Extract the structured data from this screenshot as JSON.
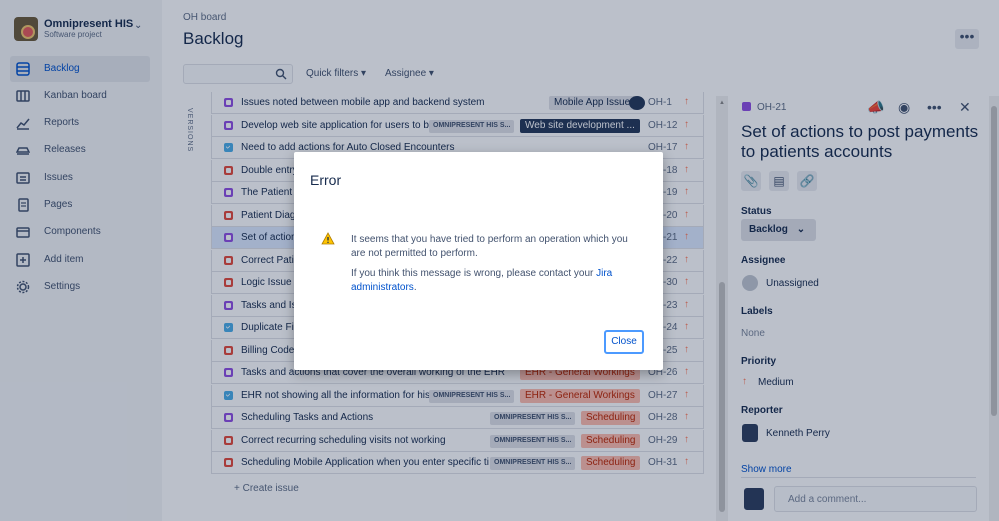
{
  "sidebar": {
    "project_name": "Omnipresent HIS",
    "project_type": "Software project",
    "items": [
      {
        "label": "Backlog",
        "icon": "backlog-icon",
        "active": true
      },
      {
        "label": "Kanban board",
        "icon": "board-icon"
      },
      {
        "label": "Reports",
        "icon": "reports-icon"
      },
      {
        "label": "Releases",
        "icon": "releases-icon"
      },
      {
        "label": "Issues",
        "icon": "issues-icon"
      },
      {
        "label": "Pages",
        "icon": "pages-icon"
      },
      {
        "label": "Components",
        "icon": "components-icon"
      },
      {
        "label": "Add item",
        "icon": "add-item-icon"
      },
      {
        "label": "Settings",
        "icon": "settings-icon"
      }
    ]
  },
  "header": {
    "breadcrumb": "OH board",
    "title": "Backlog",
    "more_label": "•••"
  },
  "toolbar": {
    "search_placeholder": "",
    "quick_filters": "Quick filters",
    "assignee": "Assignee"
  },
  "versions_label": "VERSIONS",
  "issues": [
    {
      "type": "story",
      "summary": "Issues noted between mobile app and backend system",
      "lozenge": "",
      "epic": "Mobile App Issues",
      "epic_color": "#dfe1e6",
      "key": "OH-1"
    },
    {
      "type": "story",
      "summary": "Develop web site application for users to b",
      "lozenge": "OMNIPRESENT HIS S...",
      "epic": "Web site development ...",
      "epic_color": "#253858",
      "key": "OH-12"
    },
    {
      "type": "task",
      "summary": "Need to add actions for Auto Closed Encounters",
      "lozenge": "",
      "epic": "",
      "key": "OH-17"
    },
    {
      "type": "bug",
      "summary": "Double entry",
      "lozenge": "",
      "epic": "",
      "key": "OH-18"
    },
    {
      "type": "story",
      "summary": "The Patient S",
      "lozenge": "",
      "epic": "",
      "key": "OH-19"
    },
    {
      "type": "bug",
      "summary": "Patient Diagn",
      "lozenge": "",
      "epic": "",
      "key": "OH-20"
    },
    {
      "type": "story",
      "summary": "Set of action",
      "lozenge": "",
      "epic": "",
      "key": "OH-21",
      "selected": true
    },
    {
      "type": "bug",
      "summary": "Correct Patie",
      "lozenge": "",
      "epic": "",
      "key": "OH-22"
    },
    {
      "type": "bug",
      "summary": "Logic Issue w",
      "lozenge": "",
      "epic": "",
      "key": "OH-30"
    },
    {
      "type": "story",
      "summary": "Tasks and Iss",
      "lozenge": "",
      "epic": "",
      "key": "OH-23"
    },
    {
      "type": "task",
      "summary": "Duplicate File",
      "lozenge": "",
      "epic": "",
      "key": "OH-24"
    },
    {
      "type": "bug",
      "summary": "Billing Codes",
      "lozenge": "",
      "epic": "",
      "key": "OH-25"
    },
    {
      "type": "story",
      "summary": "Tasks and actions that cover the overall working of the EHR",
      "lozenge": "",
      "epic": "EHR - General Workings",
      "epic_color": "#ffbdad",
      "key": "OH-26"
    },
    {
      "type": "task",
      "summary": "EHR not showing all the information for histo",
      "lozenge": "OMNIPRESENT HIS S...",
      "epic": "EHR - General Workings",
      "epic_color": "#ffbdad",
      "key": "OH-27"
    },
    {
      "type": "story",
      "summary": "Scheduling Tasks and Actions",
      "lozenge": "OMNIPRESENT HIS S...",
      "epic": "Scheduling",
      "epic_color": "#ffbdad",
      "key": "OH-28"
    },
    {
      "type": "bug",
      "summary": "Correct recurring scheduling visits not working",
      "lozenge": "OMNIPRESENT HIS S...",
      "epic": "Scheduling",
      "epic_color": "#ffbdad",
      "key": "OH-29"
    },
    {
      "type": "bug",
      "summary": "Scheduling Mobile Application when you enter specific ti",
      "lozenge": "OMNIPRESENT HIS S...",
      "epic": "Scheduling",
      "epic_color": "#ffbdad",
      "key": "OH-31"
    }
  ],
  "create_issue": "+ Create issue",
  "detail": {
    "key": "OH-21",
    "title": "Set of actions to post payments to patients accounts",
    "status_label": "Status",
    "status_value": "Backlog",
    "assignee_label": "Assignee",
    "assignee_value": "Unassigned",
    "labels_label": "Labels",
    "labels_value": "None",
    "priority_label": "Priority",
    "priority_value": "Medium",
    "reporter_label": "Reporter",
    "reporter_value": "Kenneth Perry",
    "show_more": "Show more",
    "comment_placeholder": "Add a comment..."
  },
  "modal": {
    "title": "Error",
    "message": "It seems that you have tried to perform an operation which you are not permitted to perform.",
    "message2_prefix": "If you think this message is wrong, please contact your ",
    "message2_link": "Jira administrators",
    "message2_suffix": ".",
    "close_label": "Close"
  }
}
